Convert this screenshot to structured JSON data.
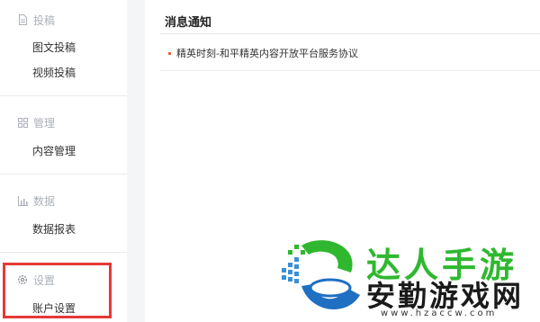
{
  "sidebar": {
    "sections": [
      {
        "title": "投稿",
        "icon": "document-icon",
        "items": [
          "图文投稿",
          "视频投稿"
        ]
      },
      {
        "title": "管理",
        "icon": "grid-icon",
        "items": [
          "内容管理"
        ]
      },
      {
        "title": "数据",
        "icon": "bar-chart-icon",
        "items": [
          "数据报表"
        ]
      },
      {
        "title": "设置",
        "icon": "gear-icon",
        "items": [
          "账户设置"
        ]
      }
    ]
  },
  "main": {
    "title": "消息通知",
    "notices": [
      "精英时刻-和平精英内容开放平台服务协议"
    ]
  },
  "watermark": {
    "line1": "达人手游",
    "line2": "安勤游戏网",
    "url": "www.hzaccw.com",
    "accent": "#2fb82f"
  }
}
